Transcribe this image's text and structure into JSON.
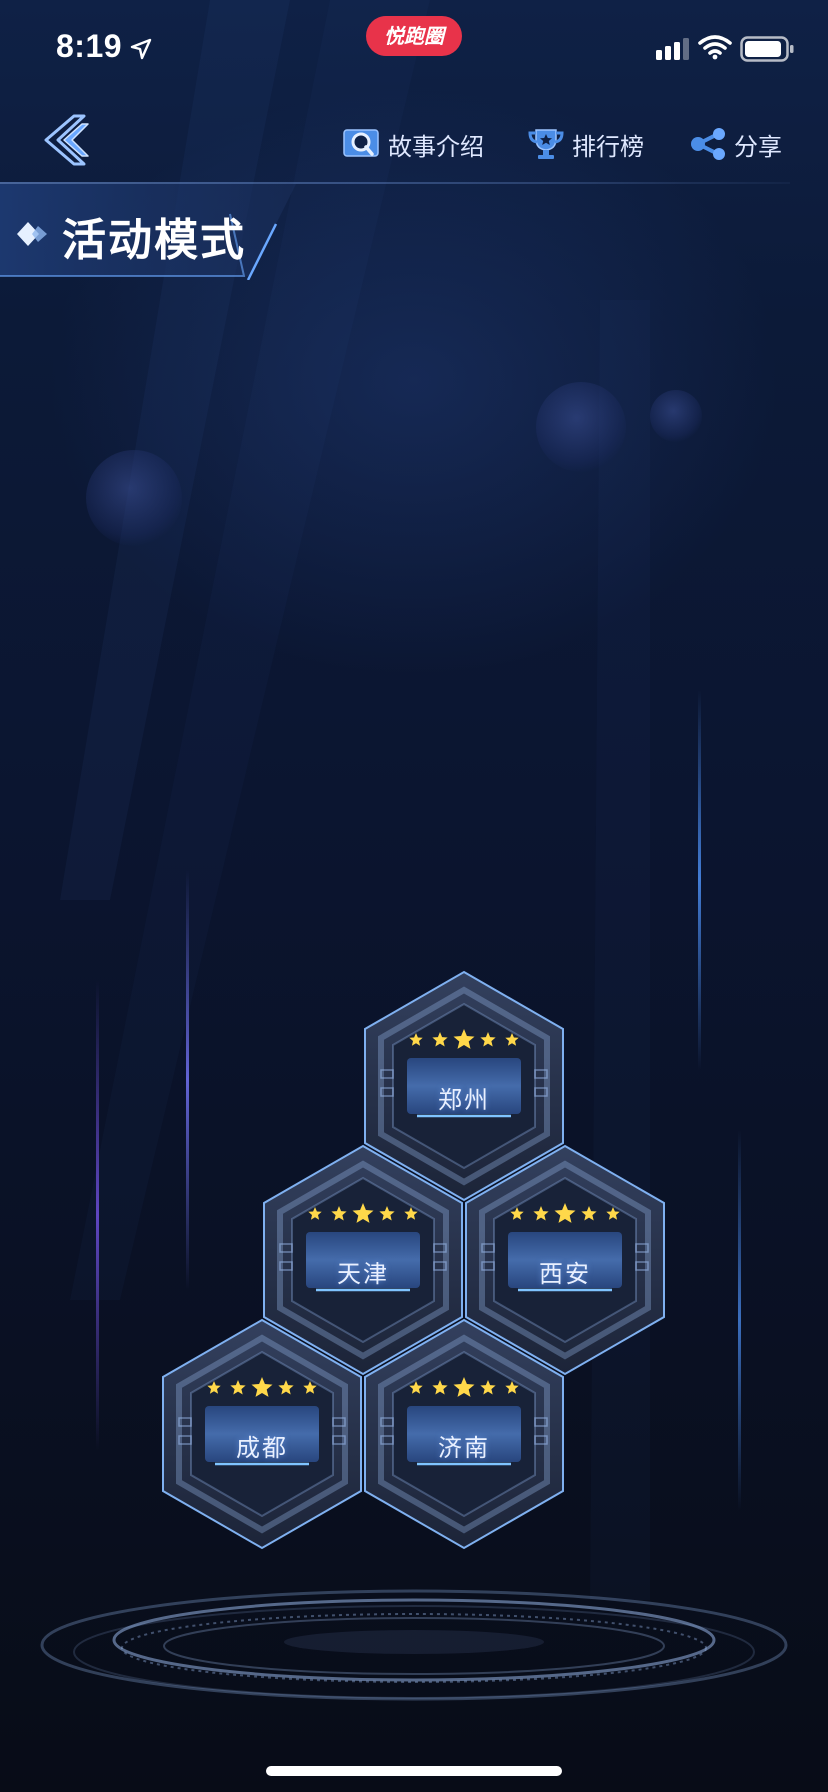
{
  "status_bar": {
    "time": "8:19",
    "brand": "悦跑圈",
    "icons": [
      "location-arrow-icon",
      "signal-icon",
      "wifi-icon",
      "battery-icon"
    ]
  },
  "nav": {
    "back_icon": "double-chevron-left-icon",
    "items": [
      {
        "label": "故事介绍",
        "icon": "book-search-icon"
      },
      {
        "label": "排行榜",
        "icon": "trophy-icon"
      },
      {
        "label": "分享",
        "icon": "share-icon"
      }
    ]
  },
  "section": {
    "title": "活动模式"
  },
  "levels": [
    {
      "city": "郑州",
      "stars": 5
    },
    {
      "city": "天津",
      "stars": 5
    },
    {
      "city": "西安",
      "stars": 5
    },
    {
      "city": "成都",
      "stars": 5
    },
    {
      "city": "济南",
      "stars": 5
    }
  ],
  "colors": {
    "accent": "#6aa8ff",
    "star": "#ffd84a",
    "badge": "#e8334a",
    "background": "#0b1530"
  }
}
